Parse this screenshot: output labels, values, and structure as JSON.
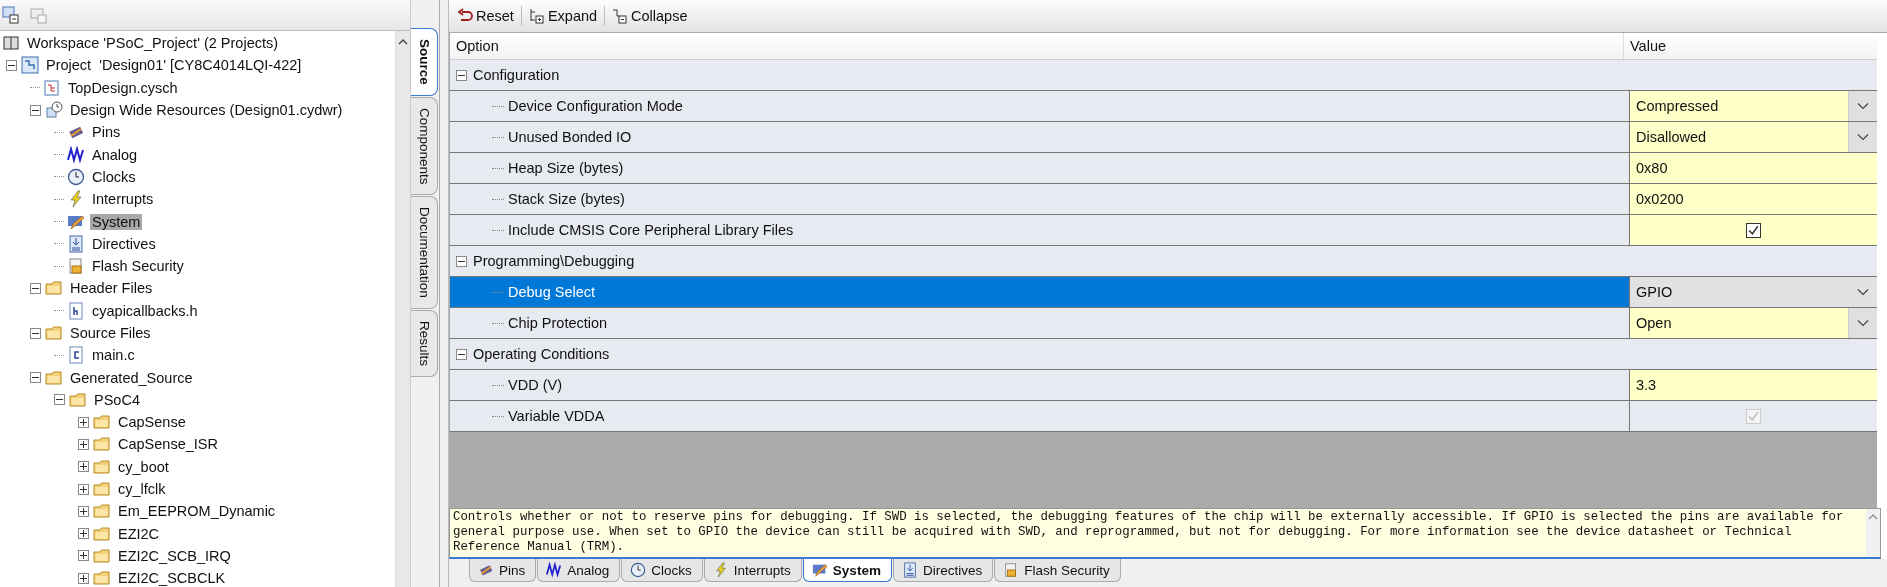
{
  "left_toolbar": {
    "buttons": [
      {
        "kind": "workspace-view"
      },
      {
        "kind": "folder-view"
      }
    ]
  },
  "tree": [
    {
      "label": "Workspace 'PSoC_Project' (2 Projects)",
      "kind": "workspace",
      "selected": false,
      "children": [
        {
          "label": "Project  'Design01' [CY8C4014LQI-422]",
          "kind": "project",
          "expanded": true,
          "selected": false,
          "children": [
            {
              "label": "TopDesign.cysch",
              "kind": "schematic",
              "selected": false
            },
            {
              "label": "Design Wide Resources (Design01.cydwr)",
              "kind": "resources",
              "expanded": true,
              "selected": false,
              "children": [
                {
                  "label": "Pins",
                  "kind": "pins",
                  "selected": false
                },
                {
                  "label": "Analog",
                  "kind": "analog",
                  "selected": false
                },
                {
                  "label": "Clocks",
                  "kind": "clock",
                  "selected": false
                },
                {
                  "label": "Interrupts",
                  "kind": "bolt",
                  "selected": false
                },
                {
                  "label": "System",
                  "kind": "system",
                  "selected": true
                },
                {
                  "label": "Directives",
                  "kind": "directives",
                  "selected": false
                },
                {
                  "label": "Flash Security",
                  "kind": "lock",
                  "selected": false
                }
              ]
            },
            {
              "label": "Header Files",
              "kind": "folder",
              "expanded": true,
              "selected": false,
              "children": [
                {
                  "label": "cyapicallbacks.h",
                  "kind": "h-file",
                  "selected": false
                }
              ]
            },
            {
              "label": "Source Files",
              "kind": "folder",
              "expanded": true,
              "selected": false,
              "children": [
                {
                  "label": "main.c",
                  "kind": "c-file",
                  "selected": false
                }
              ]
            },
            {
              "label": "Generated_Source",
              "kind": "folder",
              "expanded": true,
              "selected": false,
              "children": [
                {
                  "label": "PSoC4",
                  "kind": "folder",
                  "expanded": true,
                  "selected": false,
                  "children": [
                    {
                      "label": "CapSense",
                      "kind": "folder",
                      "expanded": false,
                      "selected": false
                    },
                    {
                      "label": "CapSense_ISR",
                      "kind": "folder",
                      "expanded": false,
                      "selected": false
                    },
                    {
                      "label": "cy_boot",
                      "kind": "folder",
                      "expanded": false,
                      "selected": false
                    },
                    {
                      "label": "cy_lfclk",
                      "kind": "folder",
                      "expanded": false,
                      "selected": false
                    },
                    {
                      "label": "Em_EEPROM_Dynamic",
                      "kind": "folder",
                      "expanded": false,
                      "selected": false
                    },
                    {
                      "label": "EZI2C",
                      "kind": "folder",
                      "expanded": false,
                      "selected": false
                    },
                    {
                      "label": "EZI2C_SCB_IRQ",
                      "kind": "folder",
                      "expanded": false,
                      "selected": false
                    },
                    {
                      "label": "EZI2C_SCBCLK",
                      "kind": "folder",
                      "expanded": false,
                      "selected": false
                    }
                  ]
                }
              ]
            }
          ]
        }
      ]
    }
  ],
  "side_tabs": [
    {
      "label": "Source",
      "selected": true
    },
    {
      "label": "Components",
      "selected": false
    },
    {
      "label": "Documentation",
      "selected": false
    },
    {
      "label": "Results",
      "selected": false
    }
  ],
  "toolbar": [
    {
      "label": "Reset",
      "kind": "reset"
    },
    {
      "label": "Expand",
      "kind": "expand"
    },
    {
      "label": "Collapse",
      "kind": "collapse"
    }
  ],
  "grid": {
    "columns": [
      "Option",
      "Value"
    ],
    "rows": [
      {
        "kind": "group",
        "label": "Configuration",
        "expanded": true
      },
      {
        "kind": "dropdown",
        "label": "Device Configuration Mode",
        "value": "Compressed",
        "selected": false
      },
      {
        "kind": "dropdown",
        "label": "Unused Bonded IO",
        "value": "Disallowed",
        "selected": false
      },
      {
        "kind": "text",
        "label": "Heap Size (bytes)",
        "value": "0x80",
        "selected": false
      },
      {
        "kind": "text",
        "label": "Stack Size (bytes)",
        "value": "0x0200",
        "selected": false
      },
      {
        "kind": "checkbox",
        "label": "Include CMSIS Core Peripheral Library Files",
        "checked": true,
        "disabled": false,
        "selected": false
      },
      {
        "kind": "group",
        "label": "Programming\\Debugging",
        "expanded": true
      },
      {
        "kind": "dropdown",
        "label": "Debug Select",
        "value": "GPIO",
        "selected": true
      },
      {
        "kind": "dropdown",
        "label": "Chip Protection",
        "value": "Open",
        "selected": false
      },
      {
        "kind": "group",
        "label": "Operating Conditions",
        "expanded": true
      },
      {
        "kind": "text",
        "label": "VDD (V)",
        "value": "3.3",
        "selected": false
      },
      {
        "kind": "checkbox",
        "label": "Variable VDDA",
        "checked": true,
        "disabled": true,
        "selected": false
      }
    ]
  },
  "description": "Controls whether or not to reserve pins for debugging. If SWD is selected, the debugging features of the chip will be externally accessible. If GPIO is selected the pins are available for general purpose use. When set to GPIO the device can still be acquired with SWD, and reprogrammed, but not for debugging. For more information see the device datasheet or Technical Reference Manual (TRM).",
  "bottom_tabs": [
    {
      "label": "Pins",
      "kind": "pins",
      "selected": false
    },
    {
      "label": "Analog",
      "kind": "analog",
      "selected": false
    },
    {
      "label": "Clocks",
      "kind": "clock",
      "selected": false
    },
    {
      "label": "Interrupts",
      "kind": "bolt",
      "selected": false
    },
    {
      "label": "System",
      "kind": "system",
      "selected": true
    },
    {
      "label": "Directives",
      "kind": "directives",
      "selected": false
    },
    {
      "label": "Flash Security",
      "kind": "lock",
      "selected": false
    }
  ]
}
